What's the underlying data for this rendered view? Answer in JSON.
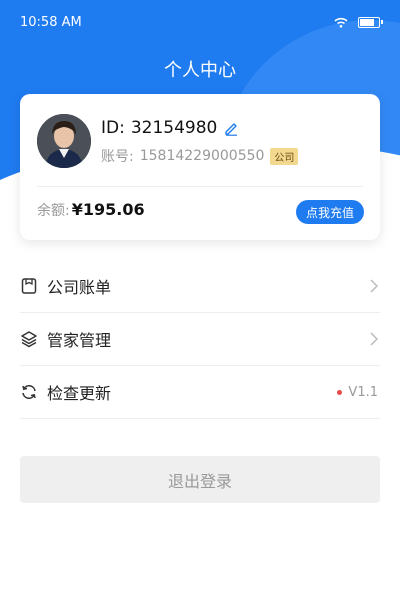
{
  "status_bar": {
    "time": "10:58 AM"
  },
  "header": {
    "title": "个人中心"
  },
  "profile": {
    "id_label": "ID:",
    "id_value": "32154980",
    "account_label": "账号:",
    "account_value": "15814229000550",
    "badge": "公司",
    "balance_label": "余额:",
    "balance_value": "¥195.06",
    "recharge_label": "点我充值"
  },
  "menu": {
    "items": [
      {
        "label": "公司账单",
        "icon": "bill-icon"
      },
      {
        "label": "管家管理",
        "icon": "layers-icon"
      },
      {
        "label": "检查更新",
        "icon": "refresh-icon",
        "version": "V1.1"
      }
    ]
  },
  "logout": {
    "label": "退出登录"
  },
  "colors": {
    "primary": "#1f7bf0",
    "badge": "#f3d98f",
    "alert": "#e84a4a"
  }
}
